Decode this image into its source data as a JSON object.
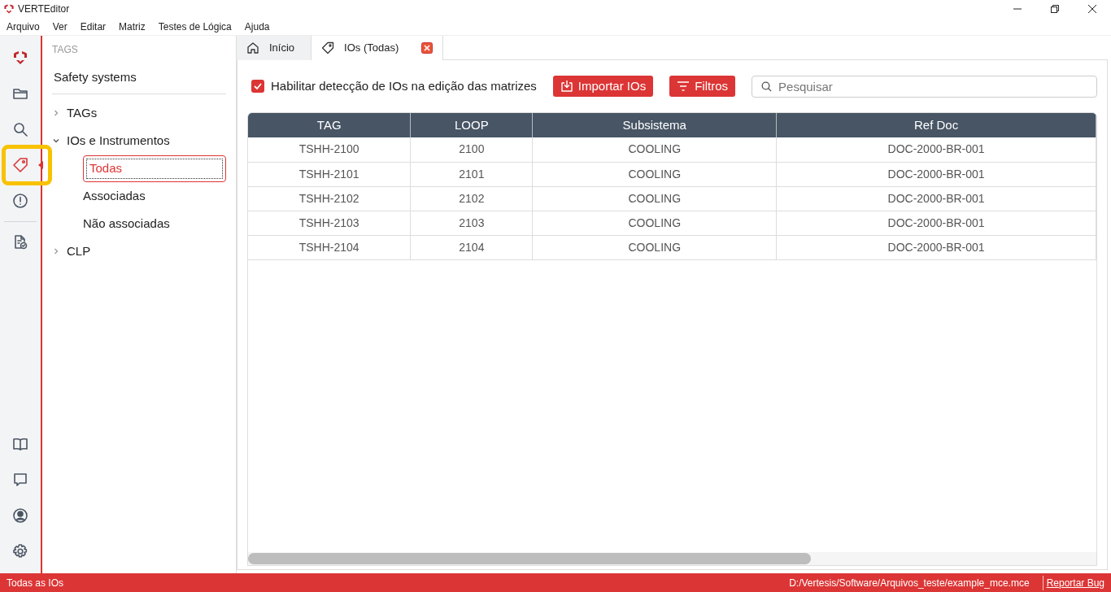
{
  "window": {
    "title": "VERTEditor"
  },
  "menu": [
    "Arquivo",
    "Ver",
    "Editar",
    "Matriz",
    "Testes de Lógica",
    "Ajuda"
  ],
  "rail": {
    "top": [
      {
        "kind": "logo",
        "selected": false
      },
      {
        "kind": "folder",
        "selected": false
      },
      {
        "kind": "search",
        "selected": false
      },
      {
        "kind": "tag",
        "selected": true
      },
      {
        "kind": "alert",
        "selected": false
      },
      {
        "kind": "report",
        "selected": false
      }
    ],
    "bottom": [
      {
        "kind": "book",
        "selected": false
      },
      {
        "kind": "chat",
        "selected": false
      },
      {
        "kind": "user",
        "selected": false
      },
      {
        "kind": "settings",
        "selected": false
      }
    ]
  },
  "sidebar": {
    "heading": "TAGS",
    "title": "Safety systems",
    "items": [
      {
        "label": "TAGs",
        "expanded": false
      },
      {
        "label": "IOs e Instrumentos",
        "expanded": true,
        "children": [
          {
            "label": "Todas",
            "selected": true
          },
          {
            "label": "Associadas",
            "selected": false
          },
          {
            "label": "Não associadas",
            "selected": false
          }
        ]
      },
      {
        "label": "CLP",
        "expanded": false
      }
    ]
  },
  "tabs": [
    {
      "kind": "home",
      "label": "Início",
      "selected": false,
      "closable": false
    },
    {
      "kind": "tag",
      "label": "IOs (Todas)",
      "selected": true,
      "closable": true
    }
  ],
  "toolbar": {
    "checkbox": {
      "label": "Habilitar detecção de IOs na edição das matrizes",
      "checked": true
    },
    "buttons": [
      {
        "kind": "import",
        "label": "Importar IOs"
      },
      {
        "kind": "filter",
        "label": "Filtros"
      }
    ],
    "search": {
      "placeholder": "Pesquisar"
    }
  },
  "table": {
    "columns": [
      "TAG",
      "LOOP",
      "Subsistema",
      "Ref Doc"
    ],
    "rows": [
      [
        "TSHH-2100",
        "2100",
        "COOLING",
        "DOC-2000-BR-001"
      ],
      [
        "TSHH-2101",
        "2101",
        "COOLING",
        "DOC-2000-BR-001"
      ],
      [
        "TSHH-2102",
        "2102",
        "COOLING",
        "DOC-2000-BR-001"
      ],
      [
        "TSHH-2103",
        "2103",
        "COOLING",
        "DOC-2000-BR-001"
      ],
      [
        "TSHH-2104",
        "2104",
        "COOLING",
        "DOC-2000-BR-001"
      ]
    ]
  },
  "status_bar": {
    "left": "Todas as IOs",
    "path": "D:/Vertesis/Software/Arquivos_teste/example_mce.mce",
    "link": "Reportar Bug"
  }
}
